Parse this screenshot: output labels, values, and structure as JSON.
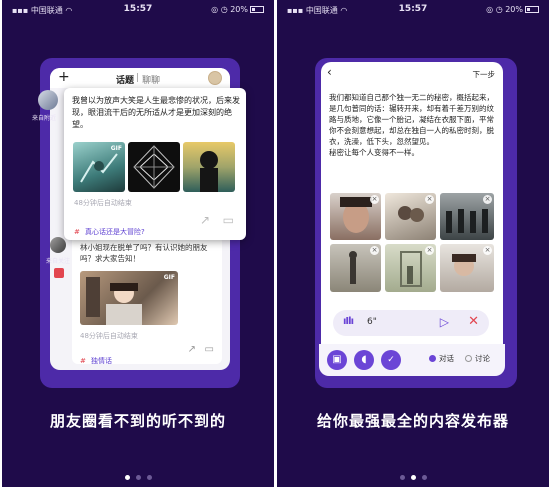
{
  "left": {
    "status": {
      "carrier": "中国联通",
      "time": "15:57",
      "battery": "20%"
    },
    "header": {
      "tab_active": "话题",
      "tab_other": "聊聊"
    },
    "side": {
      "label_top": "来自附近",
      "label_bottom": "来自关注"
    },
    "card1": {
      "text": "我曾以为放声大笑是人生最悲惨的状况，后来发现，眼泪流干后的无所适从才是更加深刻的绝望。",
      "gif_label": "GIF",
      "meta": "48分钟后自动结束",
      "topic": "真心话还是大冒险?"
    },
    "card2": {
      "text": "林小姐现在脱单了吗？有认识她的朋友吗？求大家告知！",
      "gif_label": "GIF",
      "meta": "48分钟后自动结束",
      "topic": "独情话"
    },
    "caption": "朋友圈看不到的听不到的"
  },
  "right": {
    "status": {
      "carrier": "中国联通",
      "time": "15:57",
      "battery": "20%"
    },
    "header": {
      "next": "下一步"
    },
    "body_text": "我们都知道自己那个独一无二的秘密，概括起来，是几句普同的话：辗转开来，却有着千差万别的纹路与质地，它像一个胎记，凝结在衣服下面，平常你不会刻意想起，却总在独自一人的私密时刻，脱衣，洗澡，低下头，忽然望见。\n秘密让每个人变得不一样。",
    "voice_duration": "6\"",
    "options": {
      "opt1": "对话",
      "opt2": "讨论"
    },
    "caption": "给你最强最全的内容发布器"
  },
  "colors": {
    "bg": "#1f0b4a",
    "frame": "#4d2aa8",
    "accent": "#6b45d6",
    "red": "#e2454f"
  }
}
